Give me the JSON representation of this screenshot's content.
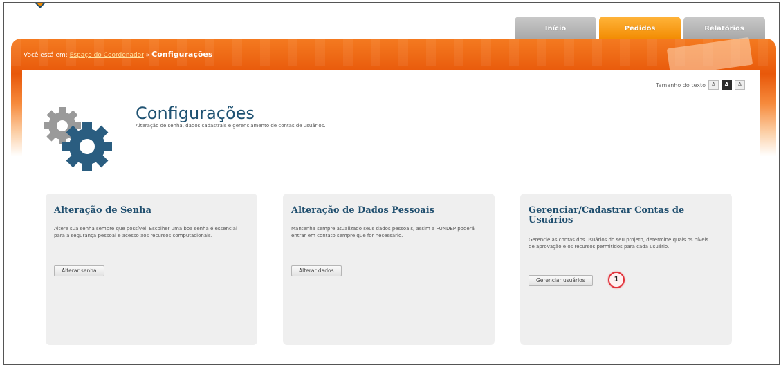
{
  "topnav": {
    "tabs": [
      {
        "label": "Início",
        "active": false
      },
      {
        "label": "Pedidos",
        "active": true
      },
      {
        "label": "Relatórios",
        "active": false
      }
    ]
  },
  "breadcrumb": {
    "prefix": "Você está em:",
    "link": "Espaço do Coordenador",
    "separator": "»",
    "current": "Configurações"
  },
  "text_size": {
    "label": "Tamanho do texto",
    "options": [
      "A",
      "A",
      "A"
    ],
    "active_index": 1
  },
  "page": {
    "title": "Configurações",
    "subtitle": "Alteração de senha, dados cadastrais e gerenciamento de contas de usuários."
  },
  "cards": [
    {
      "title": "Alteração de Senha",
      "description": "Altere sua senha sempre que possível. Escolher uma boa senha é essencial para a segurança pessoal e acesso aos recursos computacionais.",
      "button": "Alterar senha"
    },
    {
      "title": "Alteração de Dados Pessoais",
      "description": "Mantenha sempre atualizado seus dados pessoais, assim a FUNDEP poderá entrar em contato sempre que for necessário.",
      "button": "Alterar dados"
    },
    {
      "title": "Gerenciar/Cadastrar Contas de Usuários",
      "description": "Gerencie as contas dos usuários do seu projeto, determine quais os níveis de aprovação e os recursos permitidos para cada usuário.",
      "button": "Gerenciar usuários"
    }
  ],
  "step_marker": "1",
  "colors": {
    "accent_orange": "#f28a00",
    "band_orange": "#e8580a",
    "title_blue": "#1f5272",
    "marker_red": "#e2323a"
  }
}
